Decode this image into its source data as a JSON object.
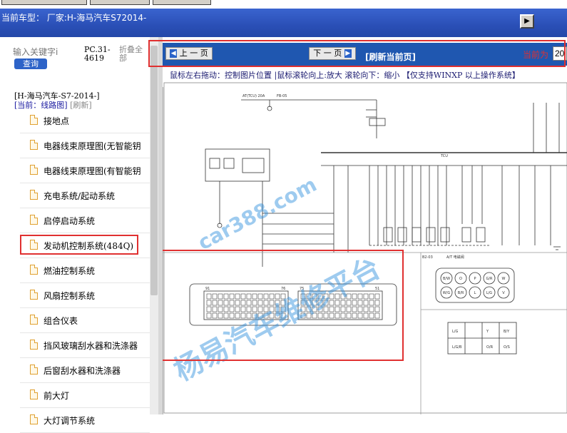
{
  "header": {
    "car_title": "当前车型：   厂家:H-海马汽车S72014-",
    "collapse_icon": "play-right-icon"
  },
  "sidebar": {
    "search_placeholder": "输入关键字i",
    "search_button": "查询",
    "pc_code": "PC.31-4619",
    "collapse_all": "折叠全部",
    "tree_root": "[H-海马汽车-S7-2014-]",
    "current_prefix": "[当前：线路图]",
    "refresh": "[刷新]",
    "items": [
      {
        "label": "接地点"
      },
      {
        "label": "电器线束原理图(无智能钥"
      },
      {
        "label": "电器线束原理图(有智能钥"
      },
      {
        "label": "充电系统/起动系统"
      },
      {
        "label": "启停启动系统"
      },
      {
        "label": "发动机控制系统(484Q)"
      },
      {
        "label": "燃油控制系统"
      },
      {
        "label": "风扇控制系统"
      },
      {
        "label": "组合仪表"
      },
      {
        "label": "挡风玻璃刮水器和洗涤器"
      },
      {
        "label": "后窗刮水器和洗涤器"
      },
      {
        "label": "前大灯"
      },
      {
        "label": "大灯调节系统"
      }
    ]
  },
  "nav": {
    "prev": "上 一 页",
    "next": "下 一 页",
    "refresh_page": "[刷新当前页]",
    "current_label": "当前为",
    "current_page": "20"
  },
  "tip": "鼠标左右拖动：控制图片位置 |鼠标滚轮向上:放大  滚轮向下：缩小 【仅支持WINXP 以上操作系统】",
  "watermark": {
    "site": "car388.com",
    "name": "杨易汽车维修平台"
  },
  "diagram_labels": {
    "tcu": "TCU",
    "fuse": "AT(TCU) 20A",
    "fb": "FB-05",
    "connector_a": "A/T 电磁阀",
    "connector_b": "B2-03",
    "grid_cells": [
      "B/W",
      "O",
      "P",
      "G/R",
      "W",
      "W/G",
      "B/R",
      "L",
      "L/G",
      "V"
    ],
    "table_cells": [
      "L/G",
      "Y",
      "B/Y",
      "L/G/B",
      "O/R",
      "O/S"
    ],
    "pins_left": [
      "91",
      "76"
    ],
    "pins_right": [
      "75",
      "51"
    ]
  },
  "colors": {
    "header_blue": "#2a4fb6",
    "nav_blue": "#1f57b0",
    "highlight_red": "#e03030",
    "watermark_blue": "#288cdc"
  }
}
